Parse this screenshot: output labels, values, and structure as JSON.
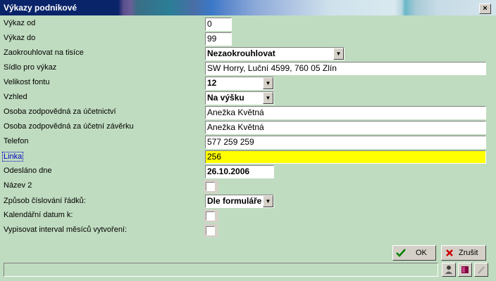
{
  "window": {
    "title": "Výkazy podnikové",
    "close_glyph": "×"
  },
  "form": {
    "vykaz_od": {
      "label": "Výkaz od",
      "value": "0"
    },
    "vykaz_do": {
      "label": "Výkaz do",
      "value": "99"
    },
    "zaokrouhlovat": {
      "label": "Zaokrouhlovat na tisíce",
      "value": "Nezaokrouhlovat"
    },
    "sidlo": {
      "label": "Sídlo pro výkaz",
      "value": "SW Horry, Luční 4599, 760 05  Zlín"
    },
    "velikost_fontu": {
      "label": "Velikost fontu",
      "value": "12"
    },
    "vzhled": {
      "label": "Vzhled",
      "value": "Na výšku"
    },
    "osoba_ucetnictvi": {
      "label": "Osoba zodpovědná za účetnictví",
      "value": "Anežka Květná"
    },
    "osoba_zaverka": {
      "label": "Osoba zodpovědná za účetní závěrku",
      "value": "Anežka Květná"
    },
    "telefon": {
      "label": "Telefon",
      "value": "577 259 259"
    },
    "linka": {
      "label": "Linka",
      "value": "256"
    },
    "odeslano": {
      "label": "Odesláno dne",
      "value": "26.10.2006"
    },
    "nazev2": {
      "label": "Název 2",
      "checked": false
    },
    "zpusob_cislovani": {
      "label": "Způsob číslování řádků:",
      "value": "Dle formuláře"
    },
    "kalendarni_datum": {
      "label": "Kalendářní datum k:",
      "checked": false
    },
    "interval_mesicu": {
      "label": "Vypisovat interval měsíců vytvoření:",
      "checked": false
    }
  },
  "buttons": {
    "ok": "OK",
    "cancel": "Zrušit"
  },
  "icons": {
    "arrow": "▼",
    "ok_icon": "check-icon",
    "cancel_icon": "x-icon"
  },
  "colors": {
    "background": "#c0dcc0",
    "highlight_field": "#ffff00",
    "titlebar": "#0a246a"
  }
}
